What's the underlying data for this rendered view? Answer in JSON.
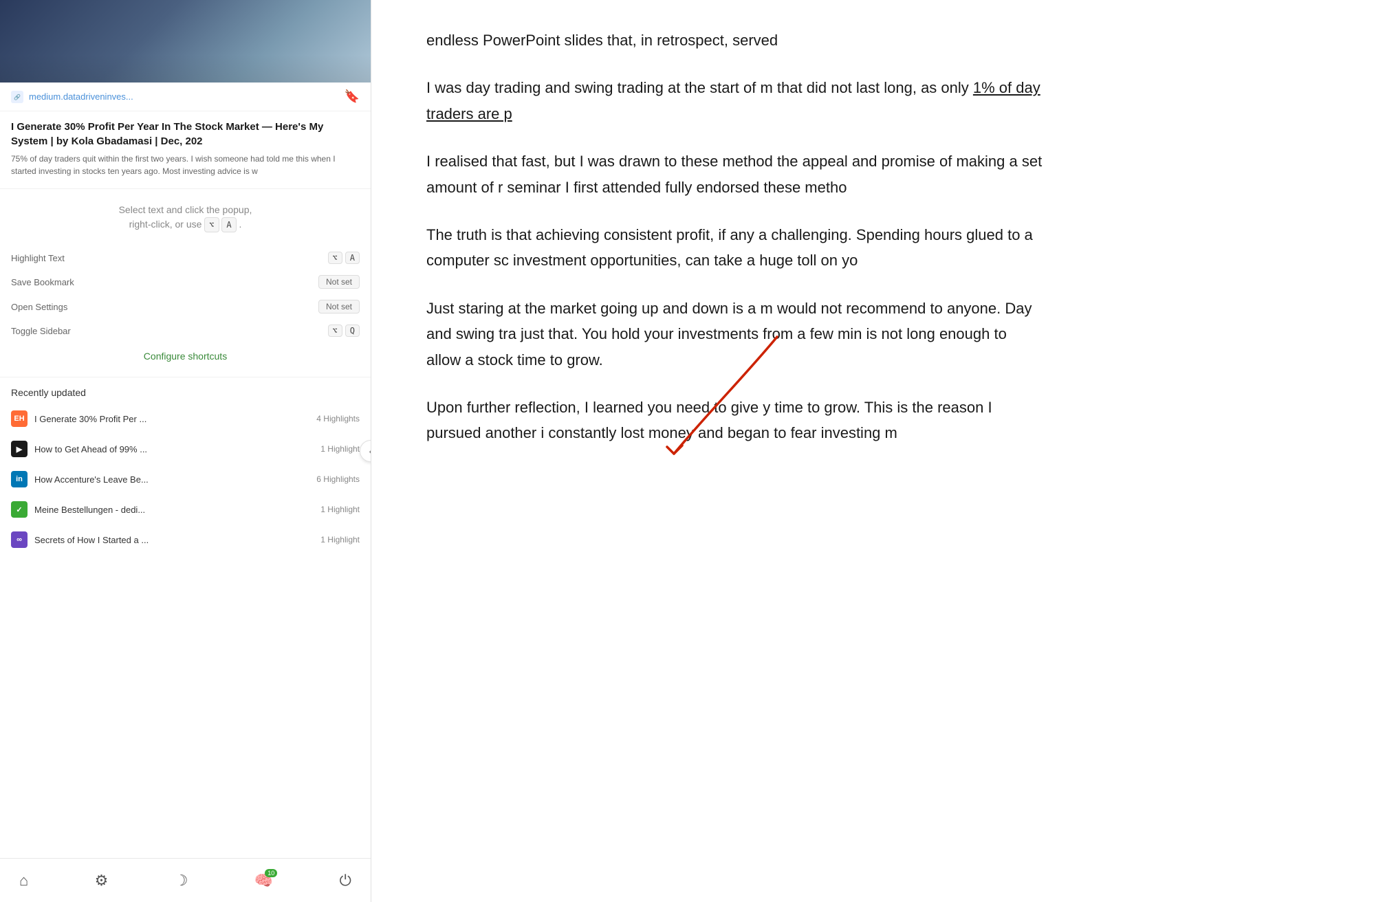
{
  "leftPanel": {
    "articlePreview": {
      "url": "medium.datadriveninves...",
      "title": "I Generate 30% Profit Per Year In The Stock Market — Here's My System | by Kola Gbadamasi | Dec, 202",
      "description": "75% of day traders quit within the first two years. I wish someone had told me this when I started investing in stocks ten years ago. Most investing advice is w"
    },
    "shortcuts": {
      "instruction_line1": "Select text and click the popup,",
      "instruction_line2": "right-click, or use",
      "highlight_text_label": "Highlight Text",
      "highlight_text_key1": "⌥",
      "highlight_text_key2": "A",
      "save_bookmark_label": "Save Bookmark",
      "save_bookmark_key": "Not set",
      "open_settings_label": "Open Settings",
      "open_settings_key": "Not set",
      "toggle_sidebar_label": "Toggle Sidebar",
      "toggle_sidebar_key1": "⌥",
      "toggle_sidebar_key2": "Q",
      "configure_link": "Configure shortcuts",
      "period_char": "."
    },
    "recentlyUpdated": {
      "section_title": "Recently updated",
      "items": [
        {
          "id": 1,
          "favicon_type": "orange",
          "favicon_text": "EH",
          "title": "I Generate 30% Profit Per ...",
          "highlights": "4 Highlights"
        },
        {
          "id": 2,
          "favicon_type": "dark",
          "favicon_text": "▶",
          "title": "How to Get Ahead of 99% ...",
          "highlights": "1 Highlight"
        },
        {
          "id": 3,
          "favicon_type": "linkedin",
          "favicon_text": "in",
          "title": "How Accenture's Leave Be...",
          "highlights": "6 Highlights"
        },
        {
          "id": 4,
          "favicon_type": "green",
          "favicon_text": "✓",
          "title": "Meine Bestellungen - dedi...",
          "highlights": "1 Highlight"
        },
        {
          "id": 5,
          "favicon_type": "purple",
          "favicon_text": "∞",
          "title": "Secrets of How I Started a ...",
          "highlights": "1 Highlight"
        }
      ]
    },
    "bottomNav": {
      "home_label": "Home",
      "settings_label": "Settings",
      "moon_label": "Moon",
      "notifications_label": "Notifications",
      "notification_count": "10",
      "power_label": "Power"
    }
  },
  "rightPanel": {
    "paragraphs": [
      "endless PowerPoint slides that, in retrospect, served",
      "I was day trading and swing trading at the start of m that did not last long, as only 1% of day traders are p",
      "I realised that fast, but I was drawn to these method the appeal and promise of making a set amount of r seminar I first attended fully endorsed these metho",
      "The truth is that achieving consistent profit, if any a challenging. Spending hours glued to a computer sc investment opportunities, can take a huge toll on yo",
      "Just staring at the market going up and down is a m would not recommend to anyone. Day and swing tra just that. You hold your investments from a few min is not long enough to allow a stock time to grow.",
      "Upon further reflection, I learned you need to give y time to grow. This is the reason I pursued another i constantly lost money and began to fear investing m"
    ]
  }
}
